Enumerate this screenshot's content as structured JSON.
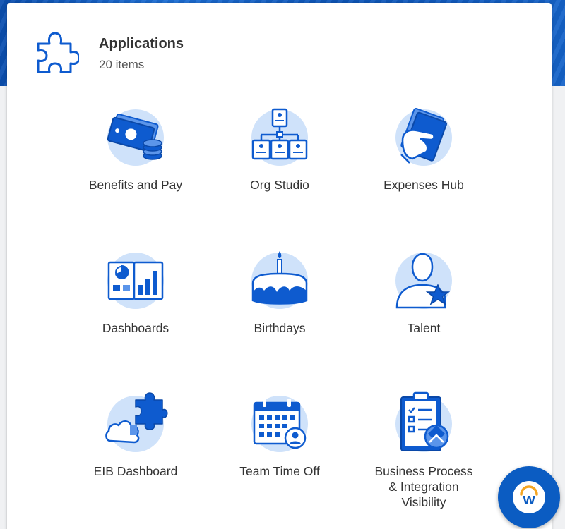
{
  "header": {
    "title": "Applications",
    "count": "20 items",
    "icon": "puzzle-icon"
  },
  "apps": [
    {
      "label": "Benefits and Pay",
      "icon": "money-coins-icon"
    },
    {
      "label": "Org Studio",
      "icon": "org-chart-icon"
    },
    {
      "label": "Expenses Hub",
      "icon": "hand-cash-icon"
    },
    {
      "label": "Dashboards",
      "icon": "dashboard-chart-icon"
    },
    {
      "label": "Birthdays",
      "icon": "birthday-cake-icon"
    },
    {
      "label": "Talent",
      "icon": "person-star-icon"
    },
    {
      "label": "EIB Dashboard",
      "icon": "puzzle-cloud-icon"
    },
    {
      "label": "Team Time Off",
      "icon": "calendar-person-icon"
    },
    {
      "label": "Business Process\n& Integration\nVisibility",
      "icon": "clipboard-checklist-icon"
    }
  ],
  "assistant": {
    "letter": "w",
    "icon": "workday-assistant-icon"
  },
  "colors": {
    "brand_blue": "#0b5cc2",
    "icon_blue": "#0e5bcf",
    "icon_circle": "#cfe2fa",
    "accent_orange": "#f5a623"
  }
}
